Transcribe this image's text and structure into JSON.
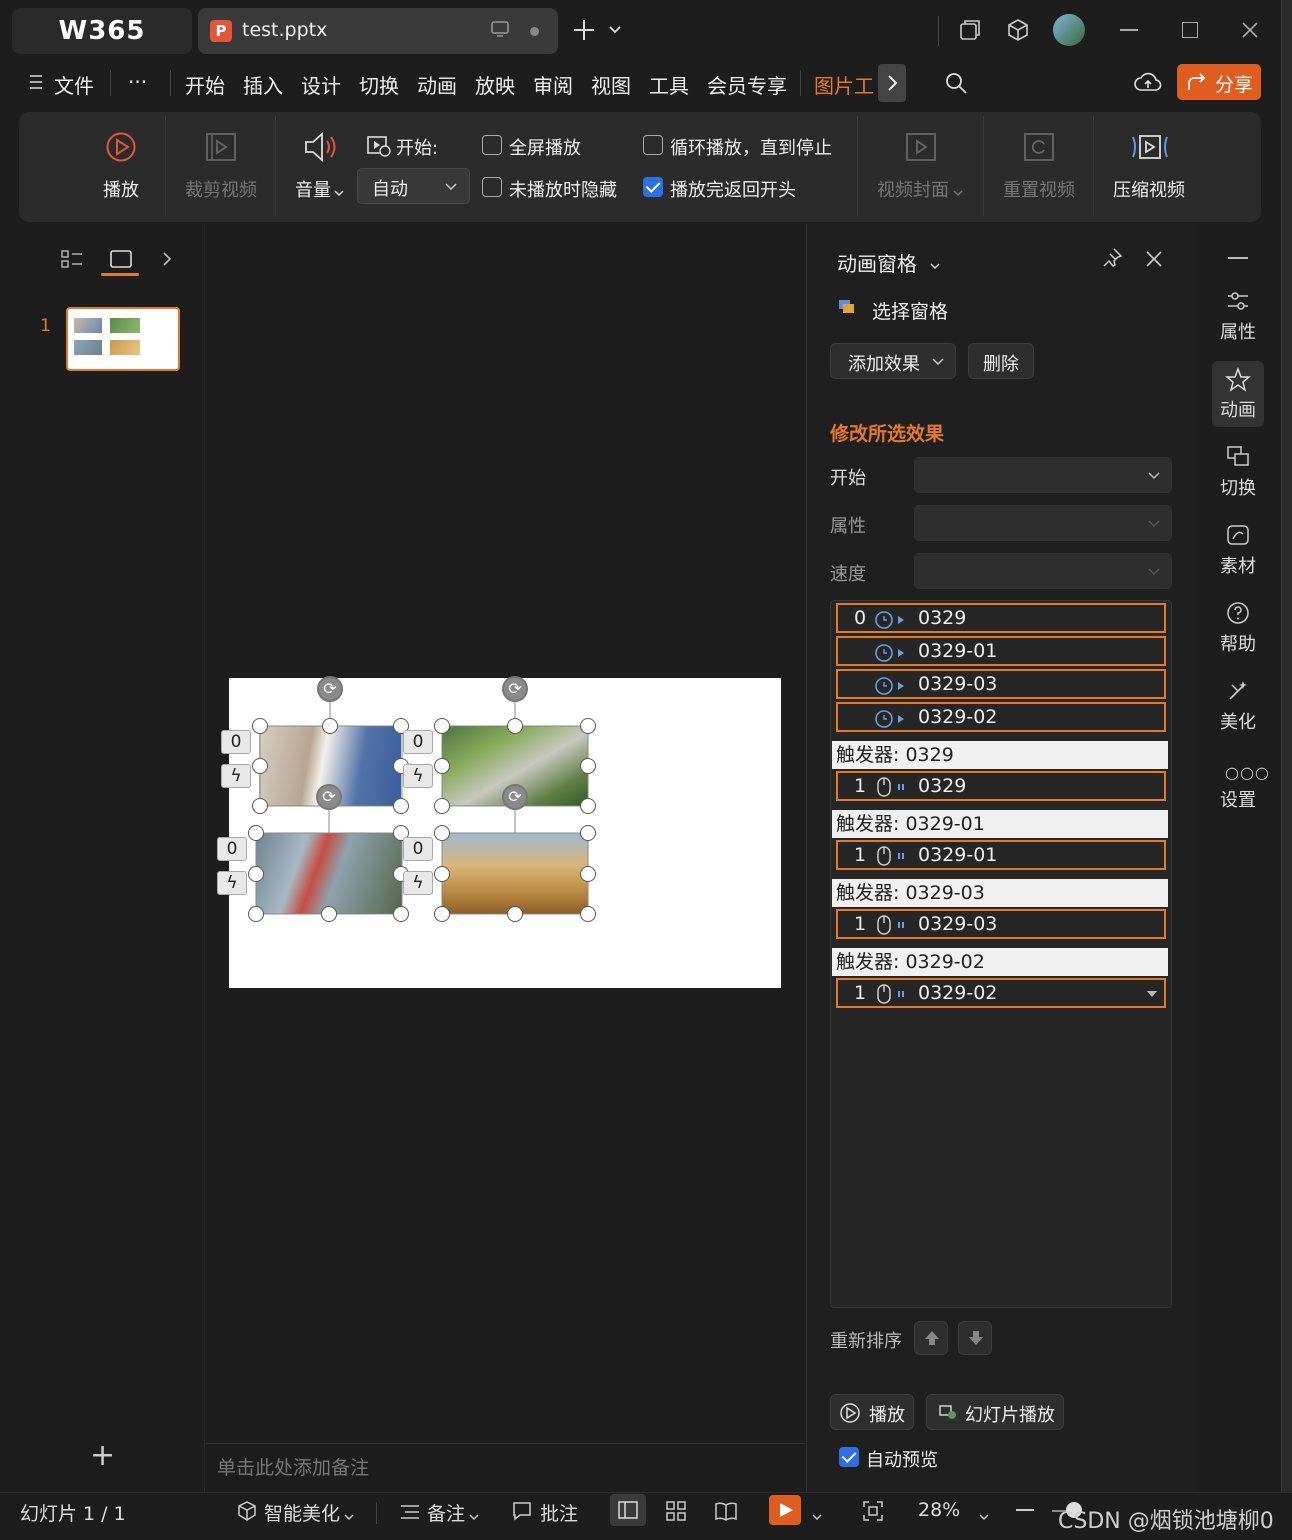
{
  "app": {
    "logo": "W365",
    "doc_tab": "test.pptx",
    "ppt_letter": "P"
  },
  "menu": {
    "file": "文件",
    "more": "···",
    "items": [
      "开始",
      "插入",
      "设计",
      "切换",
      "动画",
      "放映",
      "审阅",
      "视图",
      "工具",
      "会员专享"
    ],
    "active": "图片工",
    "share": "分享"
  },
  "ribbon": {
    "play": "播放",
    "trim": "裁剪视频",
    "volume": "音量",
    "start_label": "开始:",
    "start_value": "自动",
    "fullscreen": "全屏播放",
    "hide": "未播放时隐藏",
    "loop": "循环播放，直到停止",
    "rewind": "播放完返回开头",
    "cover": "视频封面",
    "reset": "重置视频",
    "compress": "压缩视频",
    "fullscreen_checked": false,
    "hide_checked": false,
    "loop_checked": false,
    "rewind_checked": true
  },
  "left": {
    "slide_number": "1",
    "add": "+"
  },
  "slide": {
    "tags": [
      "0",
      "0",
      "0",
      "0"
    ]
  },
  "notes": {
    "placeholder": "单击此处添加备注"
  },
  "anim": {
    "title": "动画窗格",
    "select_pane": "选择窗格",
    "add_effect": "添加效果",
    "delete": "删除",
    "modify": "修改所选效果",
    "start": "开始",
    "property": "属性",
    "speed": "速度",
    "rows": [
      {
        "num": "0",
        "name": "0329"
      },
      {
        "num": "",
        "name": "0329-01"
      },
      {
        "num": "",
        "name": "0329-03"
      },
      {
        "num": "",
        "name": "0329-02"
      }
    ],
    "triggers": [
      {
        "label": "触发器: 0329",
        "num": "1",
        "name": "0329"
      },
      {
        "label": "触发器: 0329-01",
        "num": "1",
        "name": "0329-01"
      },
      {
        "label": "触发器: 0329-03",
        "num": "1",
        "name": "0329-03"
      },
      {
        "label": "触发器: 0329-02",
        "num": "1",
        "name": "0329-02"
      }
    ],
    "reorder": "重新排序",
    "play": "播放",
    "slideshow": "幻灯片播放",
    "autopreview": "自动预览",
    "autopreview_checked": true
  },
  "rail": {
    "property": "属性",
    "animation": "动画",
    "transition": "切换",
    "material": "素材",
    "help": "帮助",
    "beautify": "美化",
    "settings": "设置"
  },
  "status": {
    "slide": "幻灯片 1 / 1",
    "beautify": "智能美化",
    "notes": "备注",
    "comment": "批注",
    "zoom": "28%",
    "watermark": "CSDN @烟锁池塘柳0"
  },
  "colors": {
    "accent": "#e3792b",
    "share": "#e05d20",
    "check": "#2f6fe4"
  }
}
